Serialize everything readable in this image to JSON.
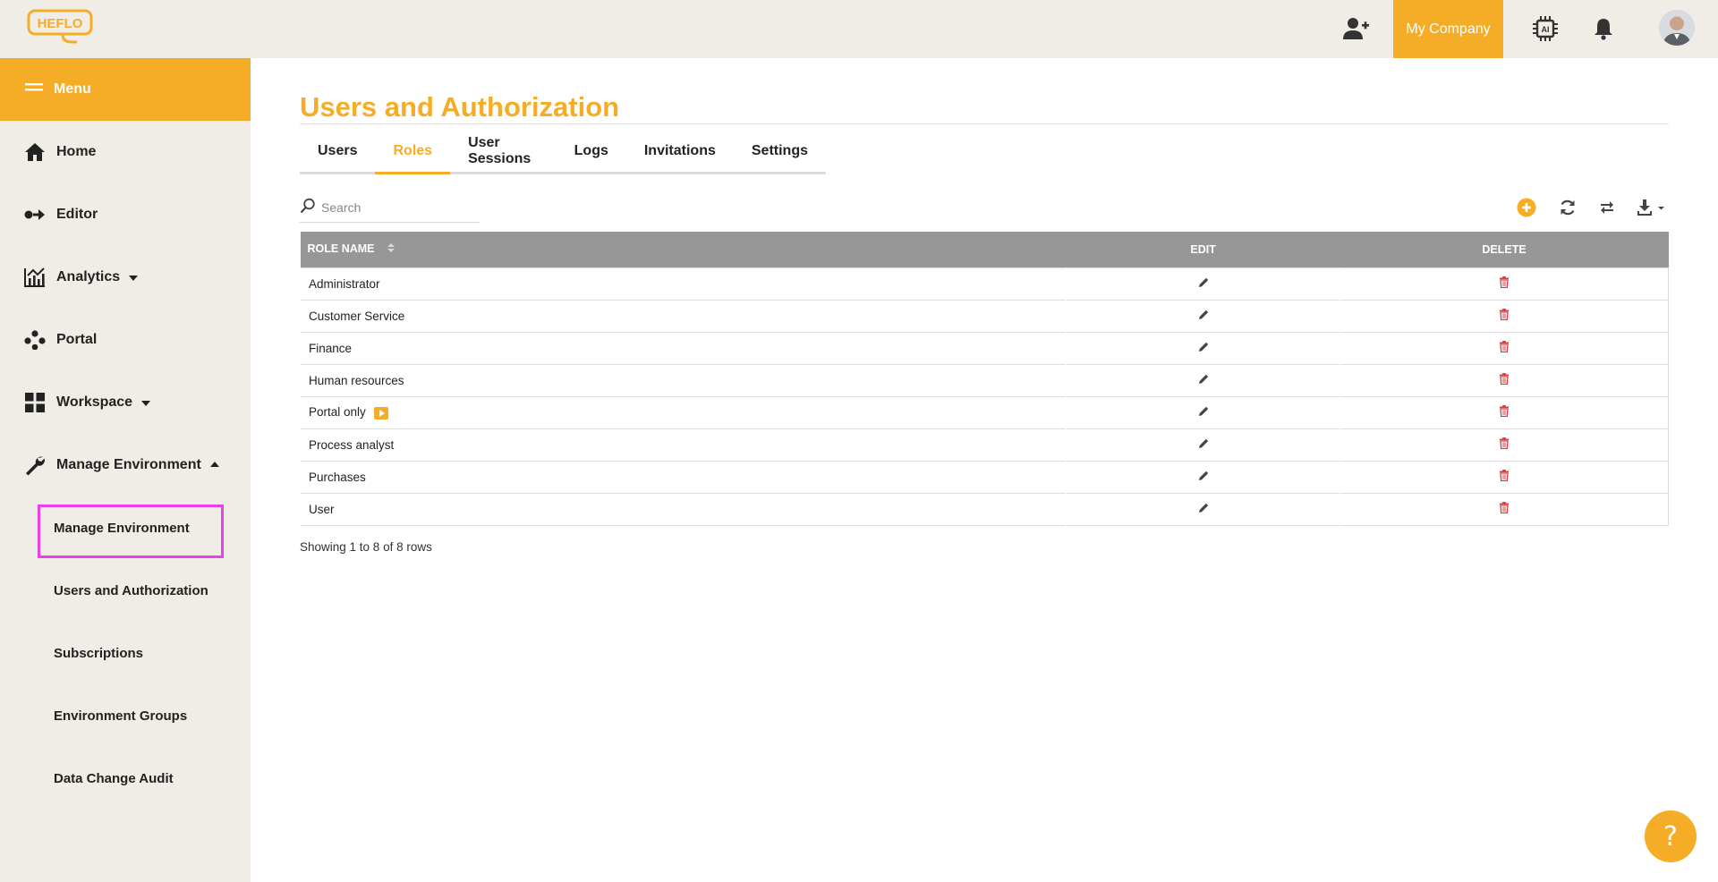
{
  "brand": {
    "logo_text": "HEFLO",
    "accent": "#f5ad27",
    "highlight": "#ee3ee8"
  },
  "topbar": {
    "icons": [
      "user-plus-icon",
      "ai-chip-icon",
      "bell-icon"
    ],
    "company_label": "My Company"
  },
  "sidebar": {
    "menu_label": "Menu",
    "items": [
      {
        "label": "Home",
        "icon": "home-icon"
      },
      {
        "label": "Editor",
        "icon": "editor-icon"
      },
      {
        "label": "Analytics",
        "icon": "analytics-icon",
        "caret": "down"
      },
      {
        "label": "Portal",
        "icon": "portal-icon"
      },
      {
        "label": "Workspace",
        "icon": "workspace-icon",
        "caret": "down"
      },
      {
        "label": "Manage Environment",
        "icon": "wrench-icon",
        "caret": "up"
      }
    ],
    "sub_items": [
      {
        "label": "Manage Environment"
      },
      {
        "label": "Users and Authorization",
        "selected": true
      },
      {
        "label": "Subscriptions"
      },
      {
        "label": "Environment Groups"
      },
      {
        "label": "Data Change Audit"
      }
    ]
  },
  "main": {
    "title": "Users and Authorization",
    "tabs": [
      {
        "label": "Users"
      },
      {
        "label": "Roles",
        "active": true
      },
      {
        "label": "User Sessions"
      },
      {
        "label": "Logs"
      },
      {
        "label": "Invitations"
      },
      {
        "label": "Settings"
      }
    ],
    "search_placeholder": "Search",
    "toolbar_icons": [
      "add-circle-icon",
      "refresh-icon",
      "columns-toggle-icon",
      "download-icon"
    ]
  },
  "table": {
    "columns": [
      "ROLE NAME",
      "EDIT",
      "DELETE"
    ],
    "rows": [
      {
        "name": "Administrator"
      },
      {
        "name": "Customer Service"
      },
      {
        "name": "Finance"
      },
      {
        "name": "Human resources"
      },
      {
        "name": "Portal only",
        "badge": "play-badge-icon"
      },
      {
        "name": "Process analyst"
      },
      {
        "name": "Purchases"
      },
      {
        "name": "User"
      }
    ],
    "footer": "Showing 1 to 8 of 8 rows"
  },
  "help": {
    "label": "?"
  }
}
